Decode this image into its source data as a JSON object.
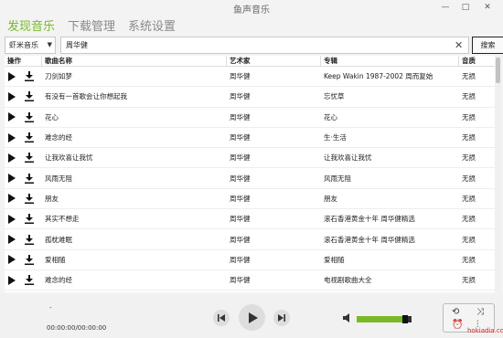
{
  "window": {
    "title": "鱼声音乐",
    "controls": [
      "—",
      "□",
      "✕"
    ]
  },
  "nav": {
    "tabs": [
      {
        "label": "发现音乐",
        "active": true
      },
      {
        "label": "下载管理",
        "active": false
      },
      {
        "label": "系统设置",
        "active": false
      }
    ]
  },
  "search": {
    "source": "虾米音乐",
    "query": "周华健",
    "clear_icon": "✕",
    "button_label": "搜索"
  },
  "table": {
    "columns": {
      "actions": "操作",
      "name": "歌曲名称",
      "artist": "艺术家",
      "album": "专辑",
      "quality": "音质"
    },
    "rows": [
      {
        "name": "刀剑如梦",
        "artist": "周华健",
        "album": "Keep Wakin 1987-2002 周而复始",
        "quality": "无损"
      },
      {
        "name": "有没有一首歌会让你想起我",
        "artist": "周华健",
        "album": "忘忧草",
        "quality": "无损"
      },
      {
        "name": "花心",
        "artist": "周华健",
        "album": "花心",
        "quality": "无损"
      },
      {
        "name": "难念的经",
        "artist": "周华健",
        "album": "生·生活",
        "quality": "无损"
      },
      {
        "name": "让我欢喜让我忧",
        "artist": "周华健",
        "album": "让我欢喜让我忧",
        "quality": "无损"
      },
      {
        "name": "风雨无阻",
        "artist": "周华健",
        "album": "风雨无阻",
        "quality": "无损"
      },
      {
        "name": "朋友",
        "artist": "周华健",
        "album": "朋友",
        "quality": "无损"
      },
      {
        "name": "其实不想走",
        "artist": "周华健",
        "album": "滚石香港黄金十年 周华健精选",
        "quality": "无损"
      },
      {
        "name": "孤枕难眠",
        "artist": "周华健",
        "album": "滚石香港黄金十年 周华健精选",
        "quality": "无损"
      },
      {
        "name": "爱相随",
        "artist": "周华健",
        "album": "爱相随",
        "quality": "无损"
      },
      {
        "name": "难念的经",
        "artist": "周华健",
        "album": "电视剧歌曲大全",
        "quality": "无损"
      }
    ]
  },
  "player": {
    "song_placeholder": "-",
    "time": "00:00:00/00:00:00",
    "volume_percent": 88,
    "watermark": "hokiadia.com"
  },
  "colors": {
    "accent": "#78b82a",
    "volume_fill": "#7ab828"
  }
}
